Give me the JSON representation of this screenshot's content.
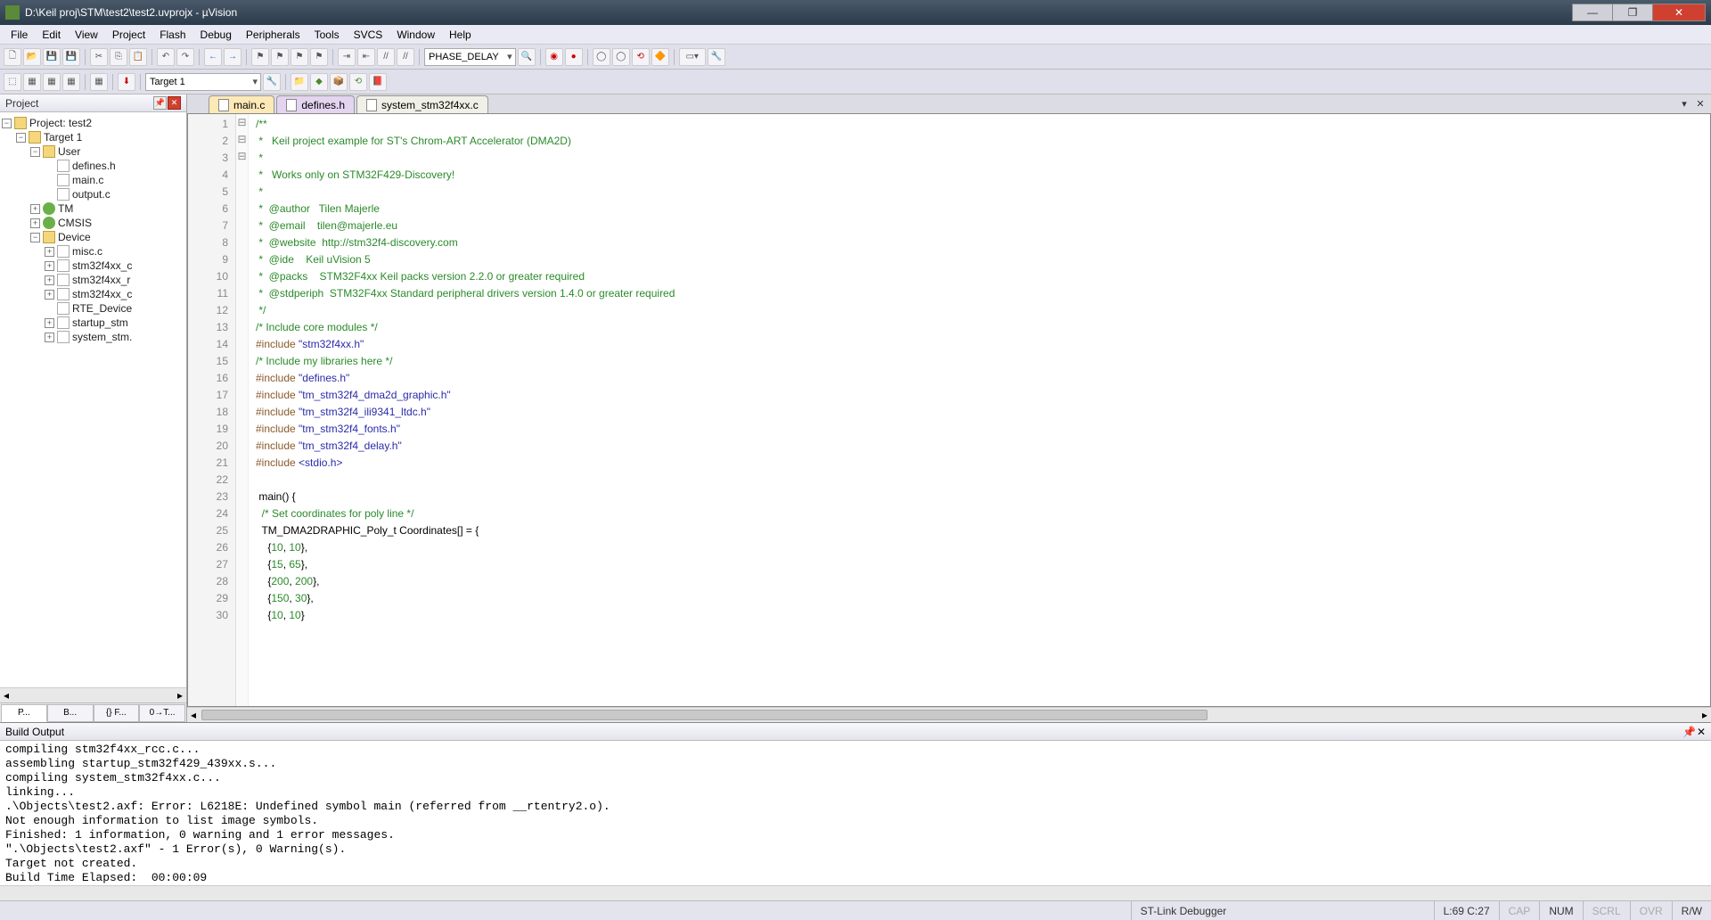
{
  "title": "D:\\Keil proj\\STM\\test2\\test2.uvprojx - µVision",
  "menu": [
    "File",
    "Edit",
    "View",
    "Project",
    "Flash",
    "Debug",
    "Peripherals",
    "Tools",
    "SVCS",
    "Window",
    "Help"
  ],
  "toolbar": {
    "combo1": "PHASE_DELAY",
    "target_combo": "Target 1"
  },
  "project_panel": {
    "title": "Project",
    "tree": {
      "project": "Project: test2",
      "target": "Target 1",
      "groups": [
        {
          "name": "User",
          "files": [
            "defines.h",
            "main.c",
            "output.c"
          ]
        },
        {
          "name": "TM",
          "files": []
        },
        {
          "name": "CMSIS",
          "files": []
        },
        {
          "name": "Device",
          "files": [
            "misc.c",
            "stm32f4xx_c",
            "stm32f4xx_r",
            "stm32f4xx_c",
            "RTE_Device",
            "startup_stm",
            "system_stm."
          ]
        }
      ]
    },
    "tabs": [
      "P...",
      "B...",
      "{} F...",
      "0→T..."
    ]
  },
  "editor": {
    "tabs": [
      "main.c",
      "defines.h",
      "system_stm32f4xx.c"
    ],
    "active_tab": 0,
    "lines": [
      {
        "n": 1,
        "cls": "c-cm",
        "t": "/**"
      },
      {
        "n": 2,
        "cls": "c-cm",
        "t": " *   Keil project example for ST's Chrom-ART Accelerator (DMA2D)"
      },
      {
        "n": 3,
        "cls": "c-cm",
        "t": " *"
      },
      {
        "n": 4,
        "cls": "c-cm",
        "t": " *   Works only on STM32F429-Discovery!"
      },
      {
        "n": 5,
        "cls": "c-cm",
        "t": " *"
      },
      {
        "n": 6,
        "cls": "c-cm",
        "t": " *  @author   Tilen Majerle"
      },
      {
        "n": 7,
        "cls": "c-cm",
        "t": " *  @email    tilen@majerle.eu"
      },
      {
        "n": 8,
        "cls": "c-cm",
        "t": " *  @website  http://stm32f4-discovery.com"
      },
      {
        "n": 9,
        "cls": "c-cm",
        "t": " *  @ide    Keil uVision 5"
      },
      {
        "n": 10,
        "cls": "c-cm",
        "t": " *  @packs    STM32F4xx Keil packs version 2.2.0 or greater required"
      },
      {
        "n": 11,
        "cls": "c-cm",
        "t": " *  @stdperiph  STM32F4xx Standard peripheral drivers version 1.4.0 or greater required"
      },
      {
        "n": 12,
        "cls": "c-cm",
        "t": " */"
      },
      {
        "n": 13,
        "cls": "c-cm",
        "t": "/* Include core modules */"
      },
      {
        "n": 14,
        "mixed": [
          {
            "cls": "c-pp",
            "t": "#include "
          },
          {
            "cls": "c-str",
            "t": "\"stm32f4xx.h\""
          }
        ]
      },
      {
        "n": 15,
        "cls": "c-cm",
        "t": "/* Include my libraries here */"
      },
      {
        "n": 16,
        "mixed": [
          {
            "cls": "c-pp",
            "t": "#include "
          },
          {
            "cls": "c-str",
            "t": "\"defines.h\""
          }
        ]
      },
      {
        "n": 17,
        "mixed": [
          {
            "cls": "c-pp",
            "t": "#include "
          },
          {
            "cls": "c-str",
            "t": "\"tm_stm32f4_dma2d_graphic.h\""
          }
        ]
      },
      {
        "n": 18,
        "mixed": [
          {
            "cls": "c-pp",
            "t": "#include "
          },
          {
            "cls": "c-str",
            "t": "\"tm_stm32f4_ili9341_ltdc.h\""
          }
        ]
      },
      {
        "n": 19,
        "mixed": [
          {
            "cls": "c-pp",
            "t": "#include "
          },
          {
            "cls": "c-str",
            "t": "\"tm_stm32f4_fonts.h\""
          }
        ]
      },
      {
        "n": 20,
        "mixed": [
          {
            "cls": "c-pp",
            "t": "#include "
          },
          {
            "cls": "c-str",
            "t": "\"tm_stm32f4_delay.h\""
          }
        ]
      },
      {
        "n": 21,
        "mixed": [
          {
            "cls": "c-pp",
            "t": "#include "
          },
          {
            "cls": "c-str",
            "t": "<stdio.h>"
          }
        ]
      },
      {
        "n": 22,
        "cls": "",
        "t": ""
      },
      {
        "n": 23,
        "mixed": [
          {
            "cls": "",
            "t": " main"
          },
          {
            "cls": "",
            "t": "() {"
          }
        ]
      },
      {
        "n": 24,
        "cls": "c-cm",
        "t": "  /* Set coordinates for poly line */"
      },
      {
        "n": 25,
        "mixed": [
          {
            "cls": "",
            "t": "  TM_DMA2DRAPHIC_Poly_t Coordinates[] = {"
          }
        ]
      },
      {
        "n": 26,
        "mixed": [
          {
            "cls": "",
            "t": "    {"
          },
          {
            "cls": "c-num",
            "t": "10"
          },
          {
            "cls": "",
            "t": ", "
          },
          {
            "cls": "c-num",
            "t": "10"
          },
          {
            "cls": "",
            "t": "},"
          }
        ]
      },
      {
        "n": 27,
        "mixed": [
          {
            "cls": "",
            "t": "    {"
          },
          {
            "cls": "c-num",
            "t": "15"
          },
          {
            "cls": "",
            "t": ", "
          },
          {
            "cls": "c-num",
            "t": "65"
          },
          {
            "cls": "",
            "t": "},"
          }
        ]
      },
      {
        "n": 28,
        "mixed": [
          {
            "cls": "",
            "t": "    {"
          },
          {
            "cls": "c-num",
            "t": "200"
          },
          {
            "cls": "",
            "t": ", "
          },
          {
            "cls": "c-num",
            "t": "200"
          },
          {
            "cls": "",
            "t": "},"
          }
        ]
      },
      {
        "n": 29,
        "mixed": [
          {
            "cls": "",
            "t": "    {"
          },
          {
            "cls": "c-num",
            "t": "150"
          },
          {
            "cls": "",
            "t": ", "
          },
          {
            "cls": "c-num",
            "t": "30"
          },
          {
            "cls": "",
            "t": "},"
          }
        ]
      },
      {
        "n": 30,
        "mixed": [
          {
            "cls": "",
            "t": "    {"
          },
          {
            "cls": "c-num",
            "t": "10"
          },
          {
            "cls": "",
            "t": ", "
          },
          {
            "cls": "c-num",
            "t": "10"
          },
          {
            "cls": "",
            "t": "}"
          }
        ]
      }
    ],
    "fold_marks": {
      "1": "⊟",
      "23": "⊟",
      "25": "⊟"
    }
  },
  "build_output": {
    "title": "Build Output",
    "lines": [
      "compiling stm32f4xx_rcc.c...",
      "assembling startup_stm32f429_439xx.s...",
      "compiling system_stm32f4xx.c...",
      "linking...",
      ".\\Objects\\test2.axf: Error: L6218E: Undefined symbol main (referred from __rtentry2.o).",
      "Not enough information to list image symbols.",
      "Finished: 1 information, 0 warning and 1 error messages.",
      "\".\\Objects\\test2.axf\" - 1 Error(s), 0 Warning(s).",
      "Target not created.",
      "Build Time Elapsed:  00:00:09"
    ]
  },
  "status": {
    "debugger": "ST-Link Debugger",
    "pos": "L:69 C:27",
    "caps": "CAP",
    "num": "NUM",
    "scrl": "SCRL",
    "ovr": "OVR",
    "rw": "R/W"
  }
}
